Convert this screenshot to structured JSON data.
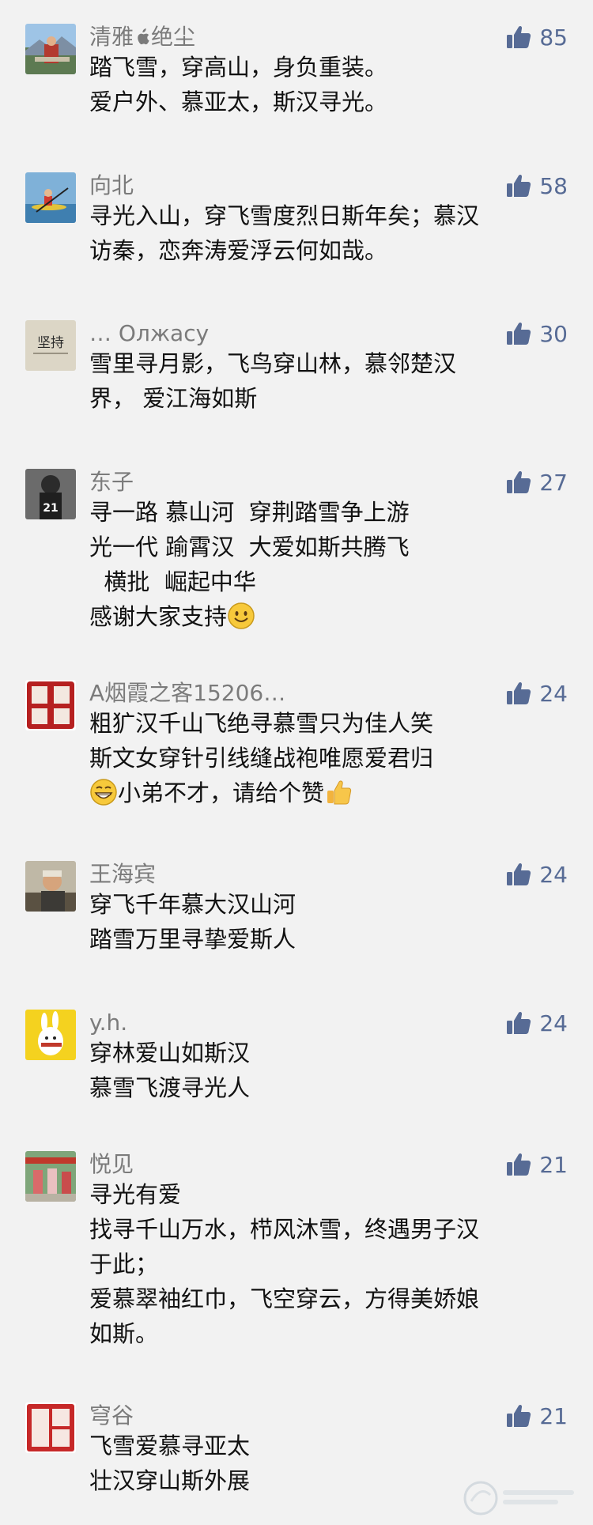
{
  "colors": {
    "background": "#f2f2f2",
    "nickname": "#7b7b7b",
    "text": "#111111",
    "like": "#576b95"
  },
  "comments": [
    {
      "nickname_a": "清雅",
      "nickname_b": "绝尘",
      "likes": "85",
      "lines": [
        "踏飞雪，穿高山，身负重装。",
        "爱户外、慕亚太，斯汉寻光。"
      ]
    },
    {
      "nickname": "向北",
      "likes": "58",
      "lines": [
        "寻光入山，穿飞雪度烈日斯年矣；慕汉",
        "访秦，恋奔涛爱浮云何如哉。"
      ]
    },
    {
      "nickname": "… Олжасу",
      "likes": "30",
      "avatar_text": "坚持",
      "lines": [
        "雪里寻月影，飞鸟穿山林，慕邻楚汉",
        "界， 爱江海如斯"
      ]
    },
    {
      "nickname": "东子",
      "likes": "27",
      "lines": [
        "寻一路 慕山河  穿荆踏雪争上游",
        "光一代 踰霄汉  大爱如斯共腾飞",
        "  横批  崛起中华",
        "感谢大家支持"
      ]
    },
    {
      "nickname": "A烟霞之客15206…",
      "likes": "24",
      "lines": [
        "粗犷汉千山飞绝寻慕雪只为佳人笑",
        "斯文女穿针引线缝战袍唯愿爱君归",
        "小弟不才，请给个赞"
      ]
    },
    {
      "nickname": "王海宾",
      "likes": "24",
      "lines": [
        "穿飞千年慕大汉山河",
        "踏雪万里寻挚爱斯人"
      ]
    },
    {
      "nickname": "y.h.",
      "likes": "24",
      "lines": [
        "穿林爱山如斯汉",
        "慕雪飞渡寻光人"
      ]
    },
    {
      "nickname": "悦见",
      "likes": "21",
      "lines": [
        "寻光有爱",
        "找寻千山万水，栉风沐雪，终遇男子汉",
        "于此；",
        "爱慕翠袖红巾，飞空穿云，方得美娇娘",
        "如斯。"
      ]
    },
    {
      "nickname": "穹谷",
      "likes": "21",
      "lines": [
        "飞雪爱慕寻亚太",
        "壮汉穿山斯外展"
      ]
    }
  ],
  "icons": {
    "like": "thumbs-up-icon",
    "apple": "apple-logo-icon",
    "smile": "smiling-face-emoji",
    "grin": "grinning-face-emoji",
    "thumb_emoji": "thumbs-up-emoji"
  }
}
